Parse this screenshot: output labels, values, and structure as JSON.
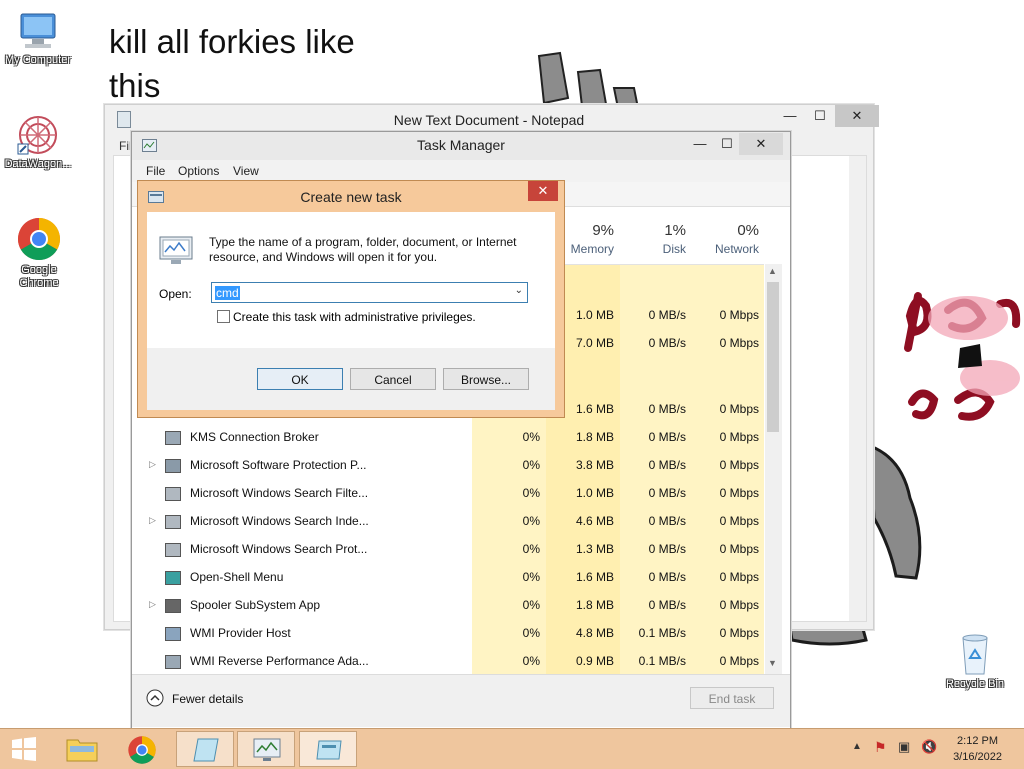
{
  "desktop": {
    "wallpaper_text": [
      "kill all forkies like",
      "this"
    ],
    "icons": [
      {
        "label": "My Computer"
      },
      {
        "label": "DataWagon..."
      },
      {
        "label": "Google Chrome"
      },
      {
        "label": "Recycle Bin"
      }
    ]
  },
  "notepad": {
    "title": "New Text Document - Notepad",
    "menu_fragment": "Fil"
  },
  "taskmgr": {
    "title": "Task Manager",
    "menu": [
      "File",
      "Options",
      "View"
    ],
    "columns": [
      {
        "pct": "9%",
        "name": "Memory"
      },
      {
        "pct": "1%",
        "name": "Disk"
      },
      {
        "pct": "0%",
        "name": "Network"
      }
    ],
    "hidden_rows": [
      {
        "memory": "1.0 MB",
        "disk": "0 MB/s",
        "network": "0 Mbps"
      },
      {
        "memory": "7.0 MB",
        "disk": "0 MB/s",
        "network": "0 Mbps"
      },
      {
        "memory": "1.6 MB",
        "disk": "0 MB/s",
        "network": "0 Mbps"
      }
    ],
    "rows": [
      {
        "name": "KMS Connection Broker",
        "expand": "",
        "cpu": "0%",
        "memory": "1.8 MB",
        "disk": "0 MB/s",
        "network": "0 Mbps"
      },
      {
        "name": "Microsoft Software Protection P...",
        "expand": "▷",
        "cpu": "0%",
        "memory": "3.8 MB",
        "disk": "0 MB/s",
        "network": "0 Mbps"
      },
      {
        "name": "Microsoft Windows Search Filte...",
        "expand": "",
        "cpu": "0%",
        "memory": "1.0 MB",
        "disk": "0 MB/s",
        "network": "0 Mbps"
      },
      {
        "name": "Microsoft Windows Search Inde...",
        "expand": "▷",
        "cpu": "0%",
        "memory": "4.6 MB",
        "disk": "0 MB/s",
        "network": "0 Mbps"
      },
      {
        "name": "Microsoft Windows Search Prot...",
        "expand": "",
        "cpu": "0%",
        "memory": "1.3 MB",
        "disk": "0 MB/s",
        "network": "0 Mbps"
      },
      {
        "name": "Open-Shell Menu",
        "expand": "",
        "cpu": "0%",
        "memory": "1.6 MB",
        "disk": "0 MB/s",
        "network": "0 Mbps"
      },
      {
        "name": "Spooler SubSystem App",
        "expand": "▷",
        "cpu": "0%",
        "memory": "1.8 MB",
        "disk": "0 MB/s",
        "network": "0 Mbps"
      },
      {
        "name": "WMI Provider Host",
        "expand": "",
        "cpu": "0%",
        "memory": "4.8 MB",
        "disk": "0.1 MB/s",
        "network": "0 Mbps"
      },
      {
        "name": "WMI Reverse Performance Ada...",
        "expand": "",
        "cpu": "0%",
        "memory": "0.9 MB",
        "disk": "0.1 MB/s",
        "network": "0 Mbps"
      }
    ],
    "fewer_details": "Fewer details",
    "end_task": "End task"
  },
  "dialog": {
    "title": "Create new task",
    "description": [
      "Type the name of a program, folder, document, or Internet",
      "resource, and Windows will open it for you."
    ],
    "open_label": "Open:",
    "open_value": "cmd",
    "checkbox_label": "Create this task with administrative privileges.",
    "ok": "OK",
    "cancel": "Cancel",
    "browse": "Browse..."
  },
  "taskbar": {
    "time": "2:12 PM",
    "date": "3/16/2022"
  },
  "colors": {
    "dialog_frame": "#f6c99b",
    "taskbar": "#efc69e",
    "heat_column": "#fff4c4"
  }
}
